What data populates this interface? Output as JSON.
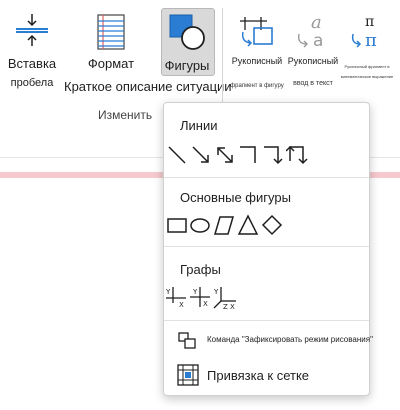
{
  "ribbon": {
    "tools": [
      {
        "name": "insert-space",
        "label": "Вставка",
        "label2": "пробела"
      },
      {
        "name": "format",
        "label": "Формат",
        "label2": "Краткое описание ситуации"
      },
      {
        "name": "shapes",
        "label": "Фигуры"
      },
      {
        "name": "ink-to-shape",
        "label": "Рукописный",
        "tiny": "фрагмент в фигуру"
      },
      {
        "name": "ink-to-text",
        "label": "Рукописный",
        "tiny": "ввод в текст"
      },
      {
        "name": "ink-to-math",
        "tiny": "Рукописный фрагмент в математическое выражение"
      }
    ],
    "group_label": "Изменить"
  },
  "menu": {
    "lines_title": "Линии",
    "basic_shapes_title": "Основные фигуры",
    "graphs_title": "Графы",
    "lock_drawing_label": "Команда \"Зафиксировать режим рисования\"",
    "snap_to_grid_label": "Привязка к сетке",
    "graph_labels": {
      "y": "Y",
      "x": "X",
      "z": "Z"
    }
  },
  "colors": {
    "accent_blue": "#2b7cd3",
    "pink_band": "#f6c9ce",
    "selected_bg": "#d9d9d9"
  }
}
